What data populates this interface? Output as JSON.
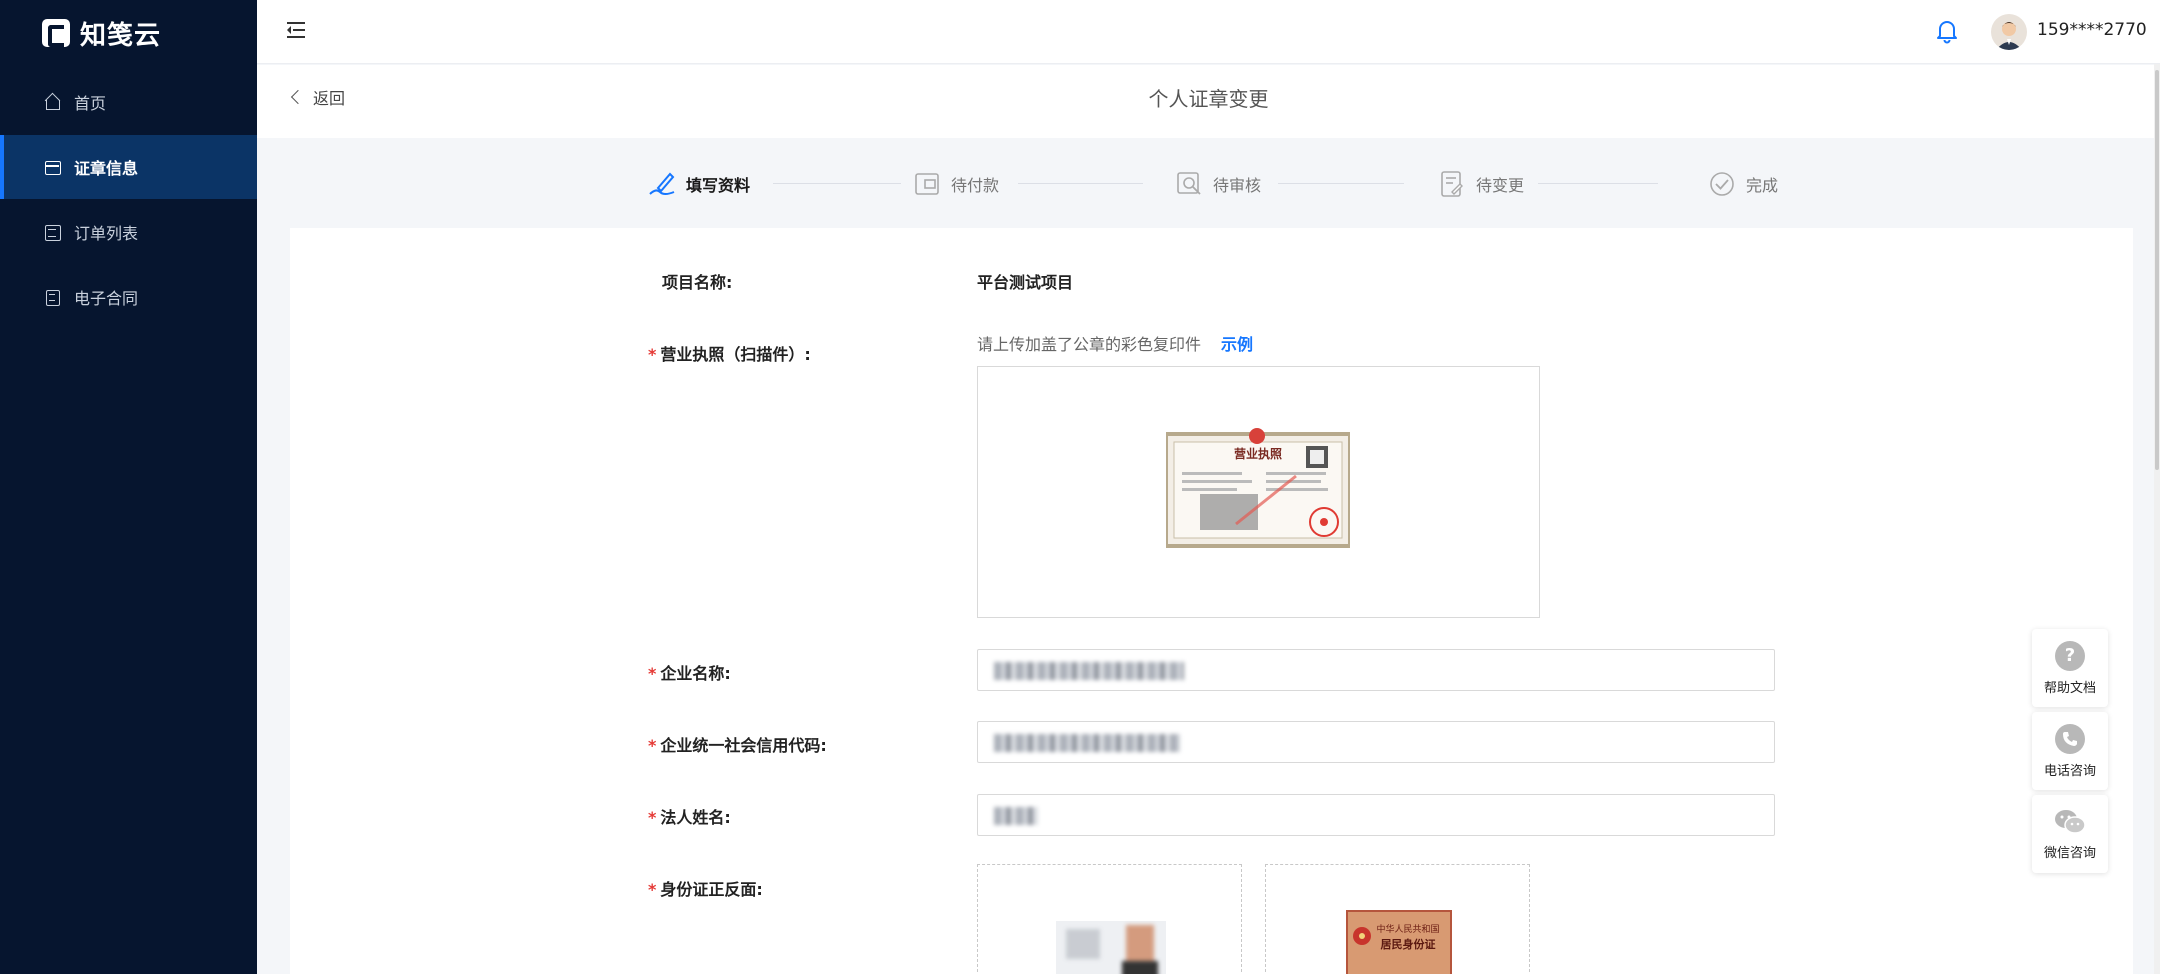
{
  "app": {
    "name": "知笺云"
  },
  "sidebar": {
    "items": [
      {
        "label": "首页",
        "icon": "home-icon",
        "active": false
      },
      {
        "label": "证章信息",
        "icon": "card-icon",
        "active": true
      },
      {
        "label": "订单列表",
        "icon": "list-icon",
        "active": false
      },
      {
        "label": "电子合同",
        "icon": "contract-icon",
        "active": false
      }
    ]
  },
  "header": {
    "user_phone": "159****2770"
  },
  "page": {
    "back_label": "返回",
    "title": "个人证章变更"
  },
  "steps": [
    {
      "label": "填写资料",
      "active": true
    },
    {
      "label": "待付款",
      "active": false
    },
    {
      "label": "待审核",
      "active": false
    },
    {
      "label": "待变更",
      "active": false
    },
    {
      "label": "完成",
      "active": false
    }
  ],
  "form": {
    "project_label": "项目名称:",
    "project_value": "平台测试项目",
    "license_label": "营业执照（扫描件）:",
    "license_hint": "请上传加盖了公章的彩色复印件",
    "license_example": "示例",
    "license_title": "营业执照",
    "company_label": "企业名称:",
    "credit_label": "企业统一社会信用代码:",
    "legal_label": "法人姓名:",
    "id_label": "身份证正反面:",
    "id_back_title1": "中华人民共和国",
    "id_back_title2": "居民身份证",
    "required_mark": "*"
  },
  "float_buttons": [
    {
      "label": "帮助文档",
      "icon": "help-icon"
    },
    {
      "label": "电话咨询",
      "icon": "phone-icon"
    },
    {
      "label": "微信咨询",
      "icon": "wechat-icon"
    }
  ],
  "colors": {
    "sidebar_bg": "#06152f",
    "active_bg": "#0b3466",
    "accent": "#1677ff",
    "required": "#e53935"
  }
}
